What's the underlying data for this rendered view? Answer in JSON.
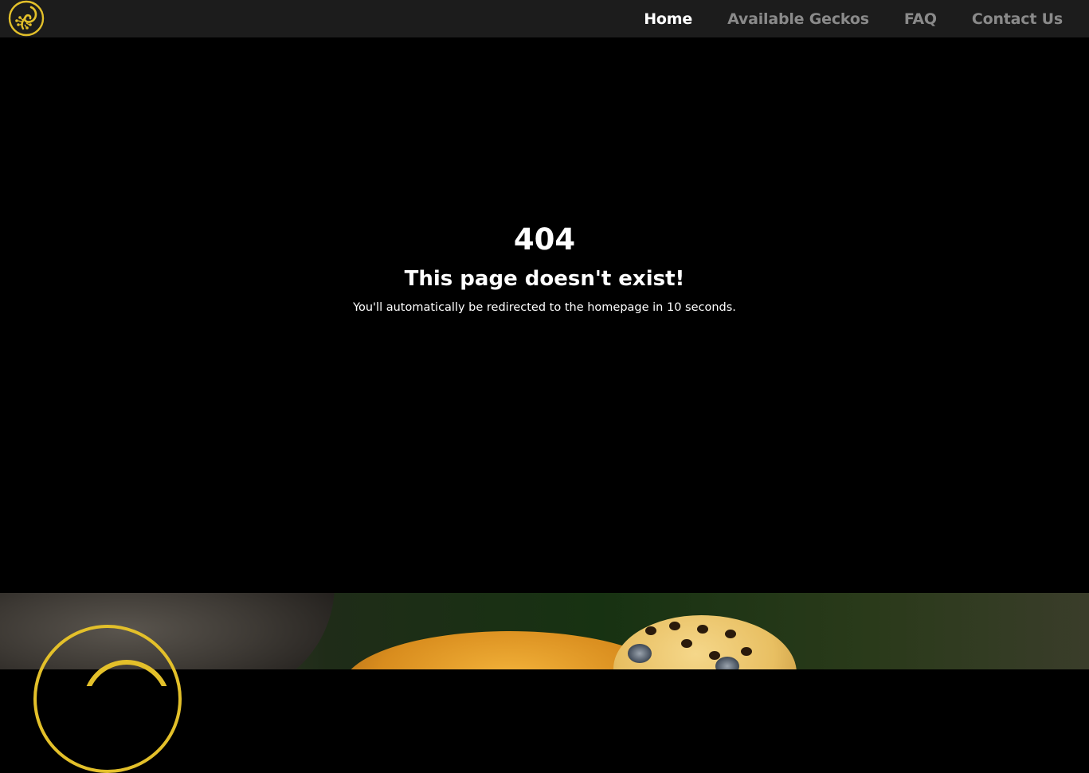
{
  "nav": {
    "items": [
      {
        "label": "Home",
        "active": true
      },
      {
        "label": "Available Geckos",
        "active": false
      },
      {
        "label": "FAQ",
        "active": false
      },
      {
        "label": "Contact Us",
        "active": false
      }
    ],
    "logo_icon": "gecko-logo-icon"
  },
  "error": {
    "code": "404",
    "title": "This page doesn't exist!",
    "redirect_message": "You'll automatically be redirected to the homepage in 10 seconds."
  },
  "colors": {
    "accent": "#e3c02a",
    "nav_background": "#1c1c1c",
    "nav_inactive": "#8a8a8a",
    "nav_active": "#ffffff",
    "page_background": "#000000"
  }
}
